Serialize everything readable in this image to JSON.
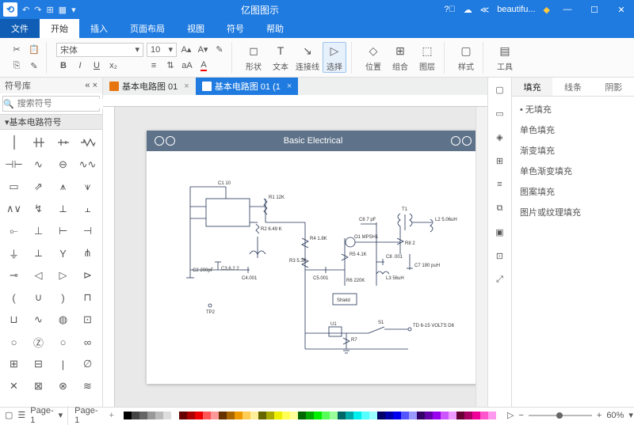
{
  "app": {
    "title": "亿图图示",
    "user": "beautifu..."
  },
  "menu": {
    "file": "文件",
    "home": "开始",
    "insert": "插入",
    "layout": "页面布局",
    "view": "视图",
    "symbol": "符号",
    "help": "帮助"
  },
  "ribbon": {
    "font": "宋体",
    "fontsize": "10",
    "shape": "形状",
    "text": "文本",
    "line": "连接线",
    "select": "选择",
    "align": "位置",
    "group": "组合",
    "layer": "图层",
    "style": "样式",
    "tools": "工具"
  },
  "symlib": {
    "title": "符号库",
    "search_ph": "搜索符号",
    "category": "基本电路符号"
  },
  "tabs": [
    {
      "label": "基本电路图 01",
      "active": false
    },
    {
      "label": "基本电路图 01 (1",
      "active": true
    }
  ],
  "page": {
    "title": "Basic Electrical"
  },
  "circuit_labels": {
    "c1": "C1 10",
    "r1": "R1\n12K",
    "r2": "R2\n6.49 K",
    "c2": "C2 200pF",
    "c3": "C3,6.2\n2",
    "c4": "C4.001",
    "tp2": "TP2",
    "r4": "R4\n1.8K",
    "r3": "R3\n5.3K",
    "c5": "C5.001",
    "r5": "R5\n4.1K",
    "r6": "R6\n220K",
    "o1": "O1\nMPSH1",
    "c6": "C6 7 pF",
    "shield": "Shield",
    "c8": "C8\n.001",
    "l3": "L3\n56uH",
    "r8": "R8\n2",
    "t1": "T1",
    "l2": "L2\n5.06uH",
    "c7": "C7 190\npuH",
    "u1": "U1",
    "r7": "R7",
    "s1": "S1",
    "td": "TD\n6-15\nVOLTS\nD6"
  },
  "proppanel": {
    "tabs": {
      "fill": "填充",
      "line": "线条",
      "shadow": "阴影"
    },
    "opts": [
      "无填充",
      "单色填充",
      "渐变填充",
      "单色渐变填充",
      "图案填充",
      "图片或纹理填充"
    ]
  },
  "status": {
    "page": "Page-1",
    "page2": "Page-1",
    "zoom": "60%"
  }
}
